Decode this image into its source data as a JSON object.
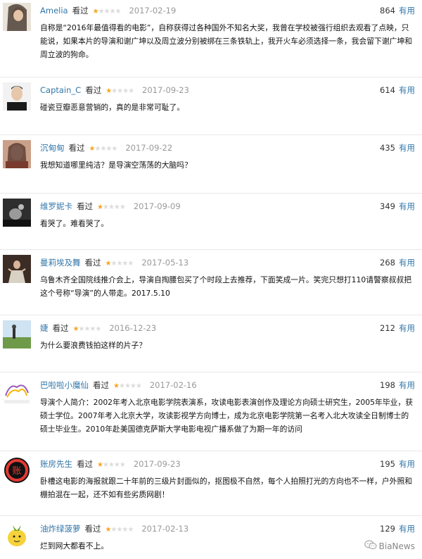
{
  "useful_label": "有用",
  "seen_label": "看过",
  "watermark": "BiaNews",
  "reviews": [
    {
      "user": "Amelia",
      "stars": 1,
      "date": "2017-02-19",
      "votes": "864",
      "text": "自称是“2016年最值得看的电影”，自称获得过各种国外不知名大奖，我曾在学校被强行组织去观看了点映，只能说，如果本片的导演和谢广坤以及周立波分别被绑在三条铁轨上，我开火车必须选择一条，我会留下谢广坤和周立波的狗命。"
    },
    {
      "user": "Captain_C",
      "stars": 1,
      "date": "2017-09-23",
      "votes": "614",
      "text": "碰瓷豆瓣恶意营销的，真的是非常可耻了。"
    },
    {
      "user": "沉甸甸",
      "stars": 1,
      "date": "2017-09-22",
      "votes": "435",
      "text": "我想知道哪里纯洁？是导演空荡荡的大脑吗？"
    },
    {
      "user": "维罗妮卡",
      "stars": 1,
      "date": "2017-09-09",
      "votes": "349",
      "text": "看哭了。难看哭了。"
    },
    {
      "user": "曼莉埃及舞",
      "stars": 1,
      "date": "2017-05-13",
      "votes": "268",
      "text": "乌鲁木齐全国院线推介会上，导演自掏腰包买了个时段上去推荐，下面笑成一片。笑完只想打110请警察叔叔把这个号称“导演”的人带走。2017.5.10"
    },
    {
      "user": "婕",
      "stars": 1,
      "date": "2016-12-23",
      "votes": "212",
      "text": "为什么要浪费钱拍这样的片子？"
    },
    {
      "user": "巴啦啦小魔仙",
      "stars": 1,
      "date": "2017-02-16",
      "votes": "198",
      "text": "导演个人简介：2002年考入北京电影学院表演系，攻读电影表演创作及理论方向硕士研究生，2005年毕业，获硕士学位。2007年考入北京大学，攻读影视学方向博士，成为北京电影学院第一名考入北大攻读全日制博士的硕士毕业生。2010年赴美国德克萨斯大学电影电视广播系做了为期一年的访问"
    },
    {
      "user": "账房先生",
      "stars": 1,
      "date": "2017-09-23",
      "votes": "195",
      "text": "卧槽这电影的海报就跟二十年前的三级片封面似的，抠图极不自然，每个人拍照打光的方向也不一样，户外照和棚拍混在一起，还不如有些劣质网剧！"
    },
    {
      "user": "油炸绿菠萝",
      "stars": 1,
      "date": "2017-02-13",
      "votes": "129",
      "text": "烂到网大都看不上。"
    }
  ]
}
